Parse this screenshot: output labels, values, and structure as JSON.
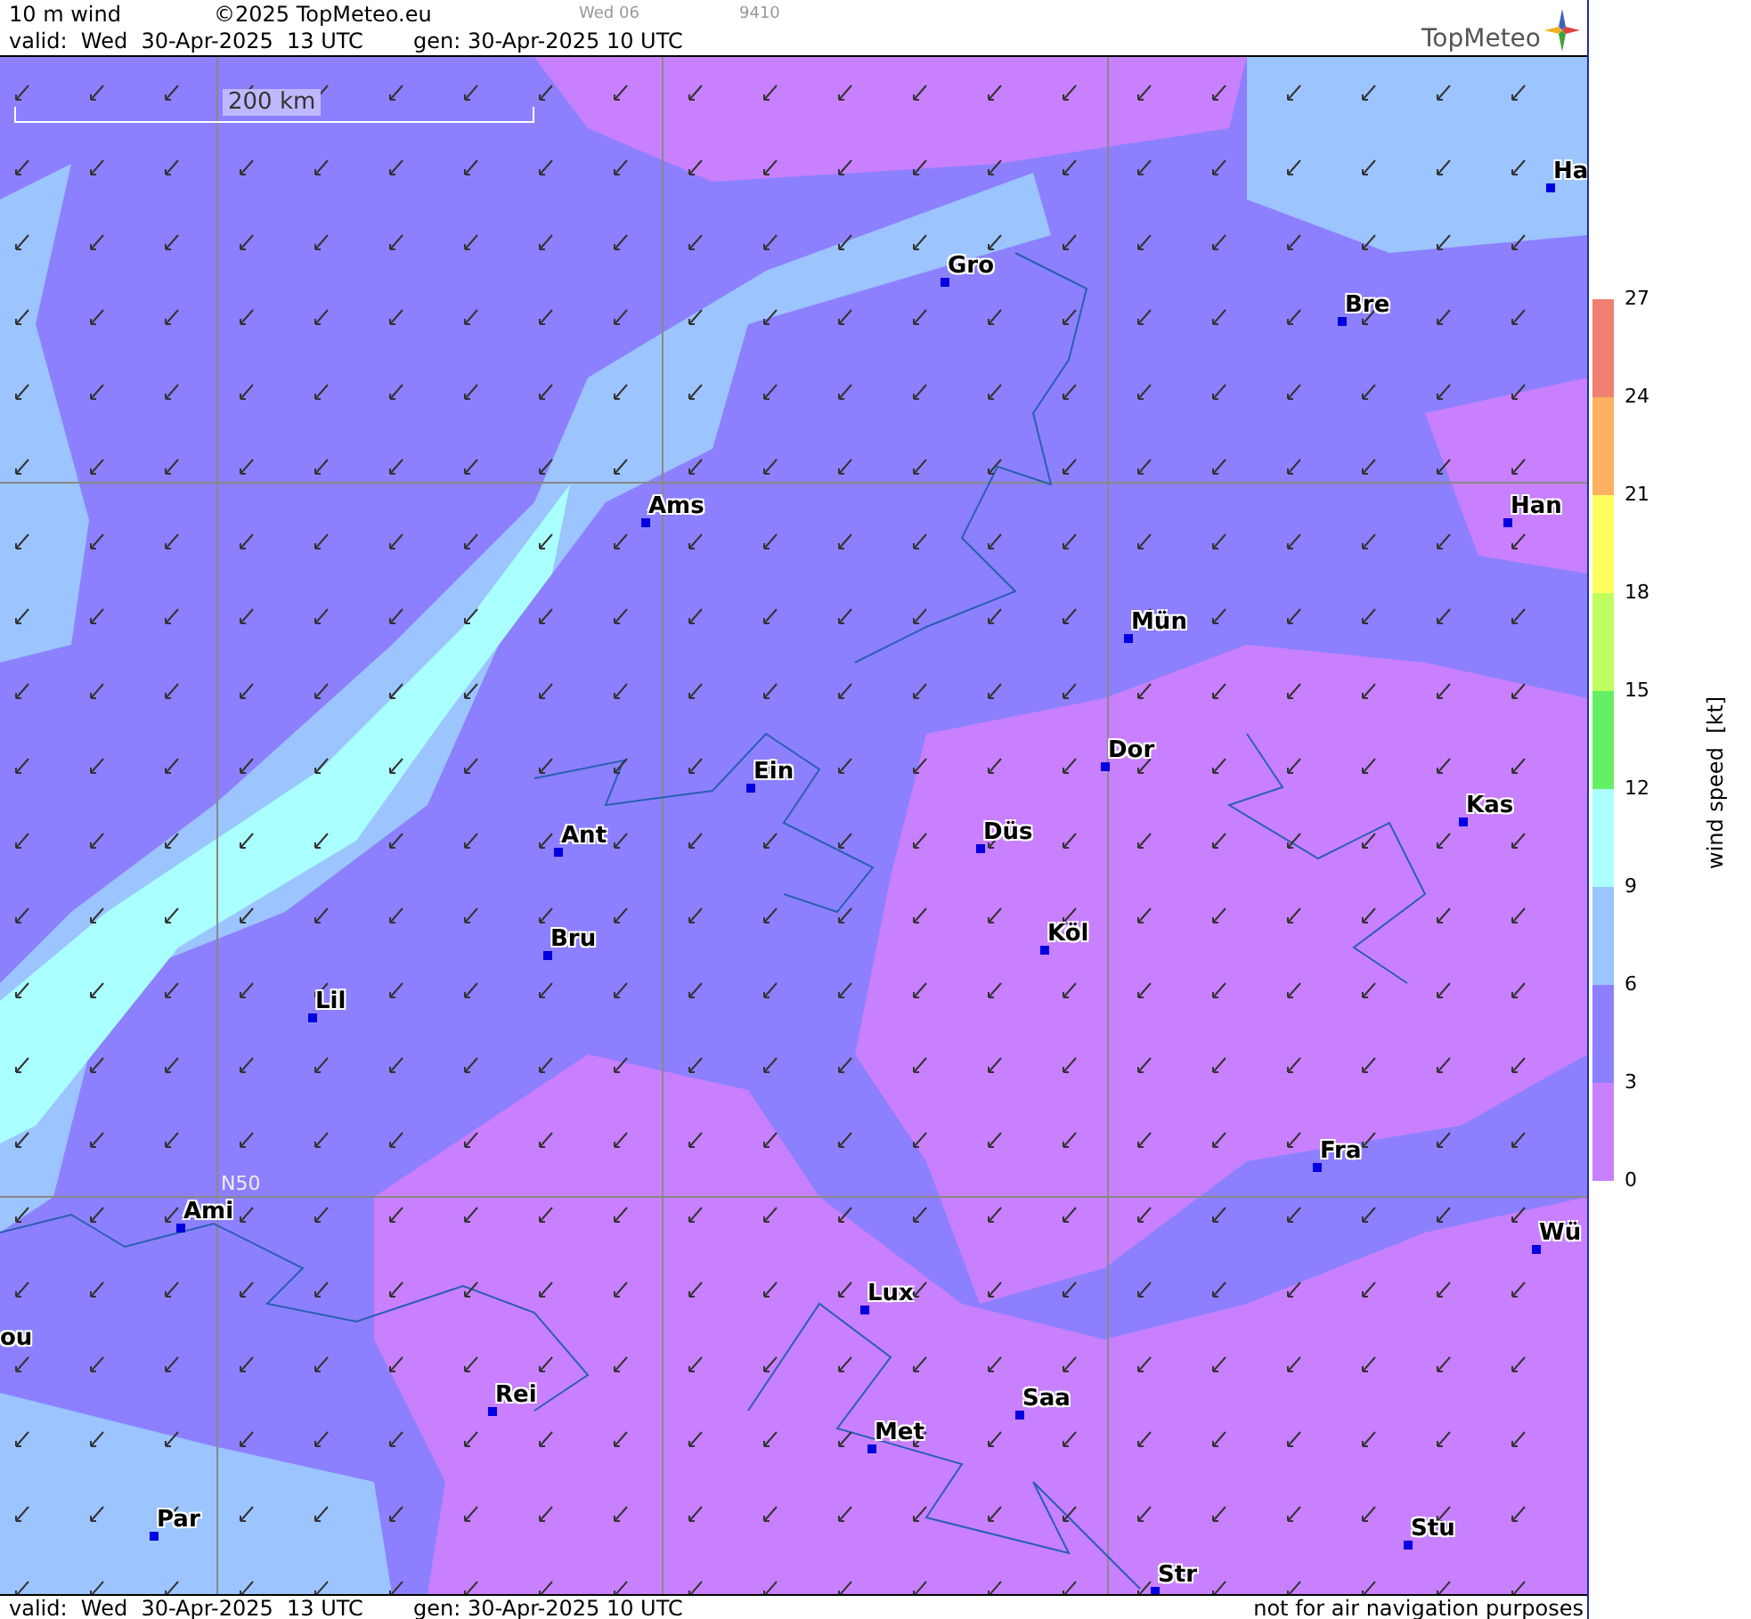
{
  "header": {
    "product": "10 m wind",
    "copyright": "©2025 TopMeteo.eu",
    "day_code": "Wed 06",
    "run_code": "9410",
    "valid": "valid:  Wed  30-Apr-2025  13 UTC",
    "generated": "gen: 30-Apr-2025 10 UTC",
    "logo": "TopMeteo"
  },
  "map": {
    "scale": "200 km",
    "latitude_label": "N50",
    "cities": [
      {
        "label": "Ha"
      },
      {
        "label": "Gro"
      },
      {
        "label": "Bre"
      },
      {
        "label": "Ams"
      },
      {
        "label": "Han"
      },
      {
        "label": "Mün"
      },
      {
        "label": "Ein"
      },
      {
        "label": "Dor"
      },
      {
        "label": "Kas"
      },
      {
        "label": "Ant"
      },
      {
        "label": "Düs"
      },
      {
        "label": "Bru"
      },
      {
        "label": "Köl"
      },
      {
        "label": "Lil"
      },
      {
        "label": "Fra"
      },
      {
        "label": "Ami"
      },
      {
        "label": "Wü"
      },
      {
        "label": "Lux"
      },
      {
        "label": "ou"
      },
      {
        "label": "Rei"
      },
      {
        "label": "Saa"
      },
      {
        "label": "Met"
      },
      {
        "label": "Par"
      },
      {
        "label": "Stu"
      },
      {
        "label": "Str"
      }
    ]
  },
  "legend": {
    "title": "wind speed  [kt]",
    "ticks": [
      "27",
      "24",
      "21",
      "18",
      "15",
      "12",
      "9",
      "6",
      "3",
      "0"
    ],
    "bands": [
      {
        "color": "#f08070"
      },
      {
        "color": "#ffb060"
      },
      {
        "color": "#ffff60"
      },
      {
        "color": "#c0ff60"
      },
      {
        "color": "#64f064"
      },
      {
        "color": "#aaffff"
      },
      {
        "color": "#9cc4ff"
      },
      {
        "color": "#8c80ff"
      },
      {
        "color": "#c880ff"
      }
    ]
  },
  "footer": {
    "valid": "valid:  Wed  30-Apr-2025  13 UTC",
    "generated": "gen: 30-Apr-2025 10 UTC",
    "disclaimer": "not for air navigation purposes"
  }
}
